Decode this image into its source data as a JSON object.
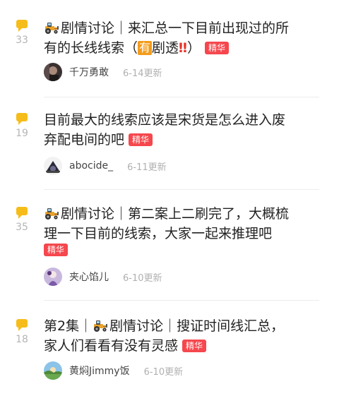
{
  "posts": [
    {
      "reply_count": "33",
      "title_line1": "剧情讨论｜来汇总一下目前出现过的所",
      "title_line2_pre": "有的长线线索（",
      "title_line2_boxed": "有",
      "title_line2_post": "剧透",
      "title_line2_close": "）",
      "exclaim": "‼",
      "badge": "精华",
      "author": "千万勇敢",
      "time": "6-14更新",
      "tractor_icon": "tractor-icon"
    },
    {
      "reply_count": "19",
      "title_line1": "目前最大的线索应该是宋货是怎么进入废",
      "title_line2": "弃配电间的吧",
      "badge": "精华",
      "author": "abocide_",
      "time": "6-11更新"
    },
    {
      "reply_count": "35",
      "title_line1": "剧情讨论｜第二案上二刷完了，大概梳",
      "title_line2": "理一下目前的线索，大家一起来推理吧",
      "badge": "精华",
      "author": "夹心馅儿",
      "time": "6-10更新",
      "tractor_icon": "tractor-icon"
    },
    {
      "reply_count": "18",
      "title_line1_pre": "第2集｜",
      "title_line1_post": "剧情讨论｜搜证时间线汇总，",
      "title_line2": "家人们看看有没有灵感",
      "badge": "精华",
      "author": "黄焖Jimmy饭",
      "time": "6-10更新",
      "tractor_icon": "tractor-icon"
    }
  ],
  "colors": {
    "bubble": "#f6bd1a",
    "badge_bg": "#f5474d",
    "boxed_bg": "#f39c1b",
    "exclaim": "#e8312b"
  }
}
